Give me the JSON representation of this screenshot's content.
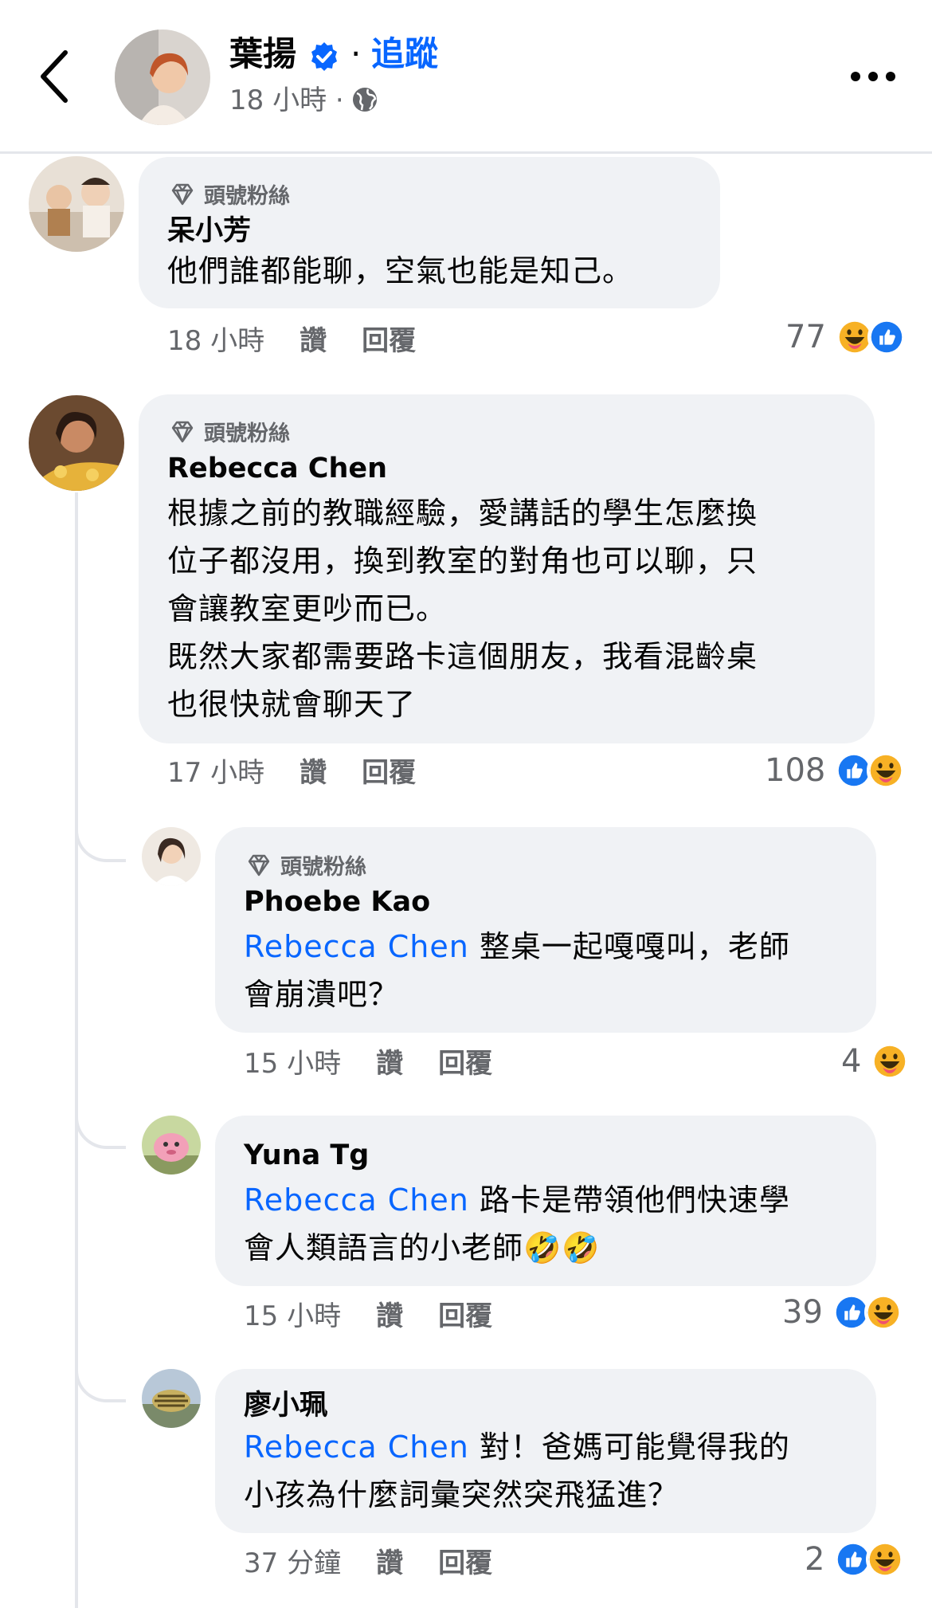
{
  "header": {
    "name": "葉揚",
    "separator": "·",
    "follow_label": "追蹤",
    "time": "18 小時 ·"
  },
  "icons": {
    "back": "chevron-left-icon",
    "verified": "verified-badge-icon",
    "privacy": "globe-icon",
    "more": "more-horizontal-icon",
    "badge": "diamond-icon",
    "like": "like-reaction-icon",
    "haha": "haha-reaction-icon"
  },
  "colors": {
    "accent": "#0866ff",
    "bubble": "#f0f2f5",
    "secondary_text": "#65676b"
  },
  "comments": [
    {
      "badge": "頭號粉絲",
      "author": "呆小芳",
      "lines": [
        "他們誰都能聊，空氣也能是知己。"
      ],
      "time": "18 小時",
      "like_label": "讚",
      "reply_label": "回覆",
      "reaction_count": "77"
    },
    {
      "badge": "頭號粉絲",
      "author": "Rebecca Chen",
      "lines": [
        "根據之前的教職經驗，愛講話的學生怎麼換",
        "位子都沒用，換到教室的對角也可以聊，只",
        "會讓教室更吵而已。",
        "既然大家都需要路卡這個朋友，我看混齡桌",
        "也很快就會聊天了"
      ],
      "time": "17 小時",
      "like_label": "讚",
      "reply_label": "回覆",
      "reaction_count": "108"
    }
  ],
  "replies": [
    {
      "badge": "頭號粉絲",
      "author": "Phoebe Kao",
      "mention": "Rebecca Chen",
      "line1": " 整桌一起嘎嘎叫，老師",
      "line2": "會崩潰吧？",
      "time": "15 小時",
      "like_label": "讚",
      "reply_label": "回覆",
      "reaction_count": "4"
    },
    {
      "author": "Yuna Tg",
      "mention": "Rebecca Chen",
      "line1": " 路卡是帶領他們快速學",
      "line2": "會人類語言的小老師🤣🤣",
      "time": "15 小時",
      "like_label": "讚",
      "reply_label": "回覆",
      "reaction_count": "39"
    },
    {
      "author": "廖小珮",
      "mention": "Rebecca Chen",
      "line1": " 對！爸媽可能覺得我的",
      "line2": "小孩為什麼詞彙突然突飛猛進？",
      "time": "37 分鐘",
      "like_label": "讚",
      "reply_label": "回覆",
      "reaction_count": "2"
    }
  ]
}
